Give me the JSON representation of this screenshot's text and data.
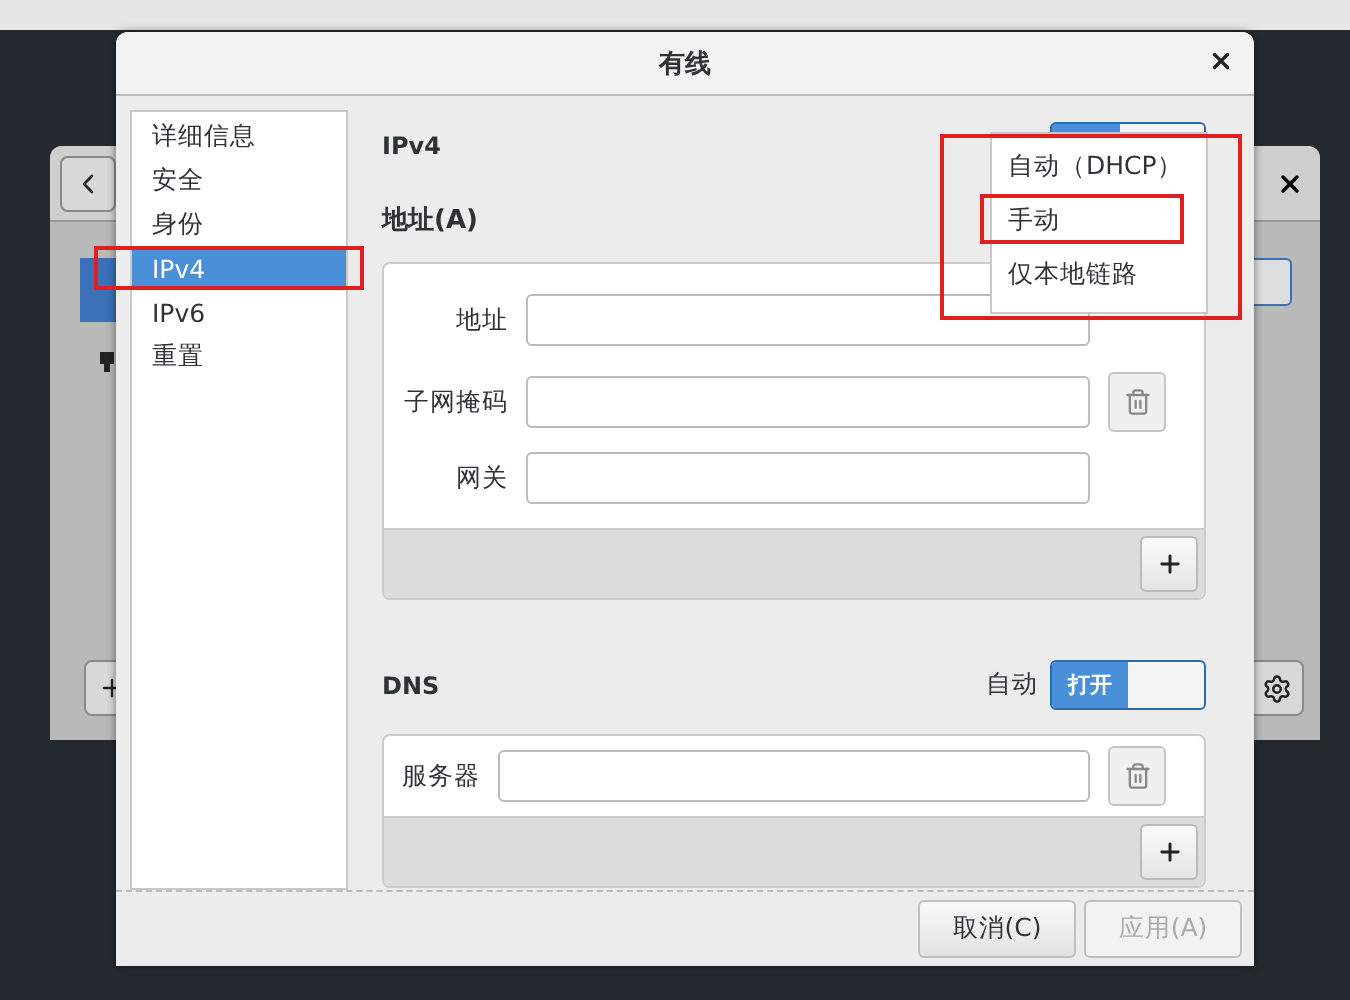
{
  "window": {
    "title": "有线"
  },
  "sidebar": {
    "items": [
      {
        "label": "详细信息",
        "selected": false,
        "annotated": false
      },
      {
        "label": "安全",
        "selected": false,
        "annotated": false
      },
      {
        "label": "身份",
        "selected": false,
        "annotated": false
      },
      {
        "label": "IPv4",
        "selected": true,
        "annotated": true
      },
      {
        "label": "IPv6",
        "selected": false,
        "annotated": false
      },
      {
        "label": "重置",
        "selected": false,
        "annotated": false
      }
    ]
  },
  "section_title": "IPv4",
  "method_menu": {
    "annotated": true,
    "items": [
      {
        "label": "自动（DHCP）",
        "annotated": false
      },
      {
        "label": "手动",
        "annotated": true
      },
      {
        "label": "仅本地链路",
        "annotated": false
      }
    ]
  },
  "address": {
    "heading": "地址(A)",
    "fields": [
      {
        "label": "地址"
      },
      {
        "label": "子网掩码"
      },
      {
        "label": "网关"
      }
    ]
  },
  "dns": {
    "heading": "DNS",
    "auto_label": "自动",
    "auto_switch": {
      "on": true,
      "label": "打开"
    },
    "fields": [
      {
        "label": "服务器"
      }
    ]
  },
  "buttons": [
    {
      "label": "取消(C)",
      "disabled": false
    },
    {
      "label": "应用(A)",
      "disabled": true
    }
  ]
}
